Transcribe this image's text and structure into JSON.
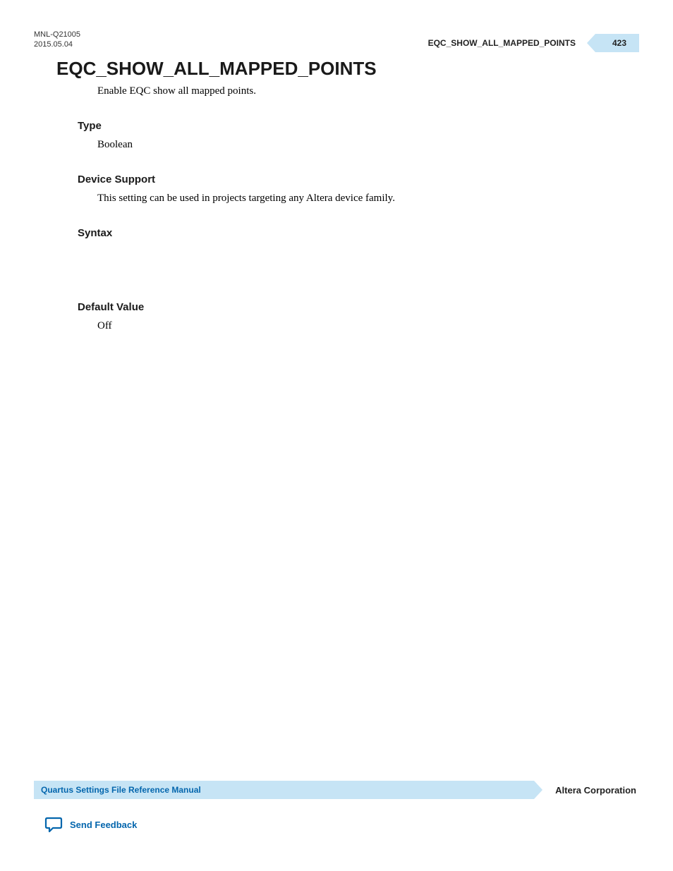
{
  "header": {
    "doc_id": "MNL-Q21005",
    "date": "2015.05.04",
    "section_name": "EQC_SHOW_ALL_MAPPED_POINTS",
    "page_number": "423"
  },
  "content": {
    "title": "EQC_SHOW_ALL_MAPPED_POINTS",
    "description": "Enable EQC show all mapped points.",
    "sections": {
      "type": {
        "heading": "Type",
        "body": "Boolean"
      },
      "device_support": {
        "heading": "Device Support",
        "body": "This setting can be used in projects targeting any Altera device family."
      },
      "syntax": {
        "heading": "Syntax"
      },
      "default_value": {
        "heading": "Default Value",
        "body": "Off"
      }
    }
  },
  "footer": {
    "manual_title": "Quartus Settings File Reference Manual",
    "corporation": "Altera Corporation",
    "feedback_label": "Send Feedback"
  }
}
